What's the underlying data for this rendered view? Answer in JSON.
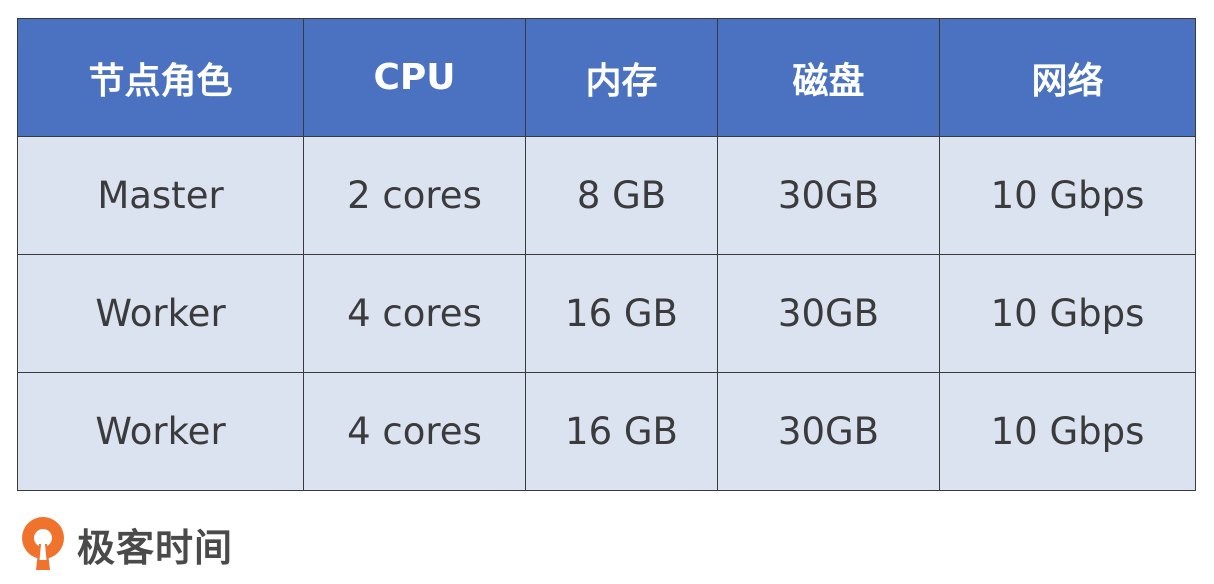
{
  "table": {
    "headers": [
      "节点角色",
      "CPU",
      "内存",
      "磁盘",
      "网络"
    ],
    "rows": [
      [
        "Master",
        "2 cores",
        "8 GB",
        "30GB",
        "10 Gbps"
      ],
      [
        "Worker",
        "4 cores",
        "16 GB",
        "30GB",
        "10 Gbps"
      ],
      [
        "Worker",
        "4 cores",
        "16 GB",
        "30GB",
        "10 Gbps"
      ]
    ]
  },
  "brand": {
    "name": "极客时间",
    "logo_icon": "geektime-logo-icon",
    "logo_color": "#f0722c"
  },
  "colors": {
    "header_bg": "#4a72c0",
    "header_text": "#ffffff",
    "row_bg": "#dbe2f0",
    "row_text": "#3b3b3b",
    "border": "#3a3a3a"
  }
}
